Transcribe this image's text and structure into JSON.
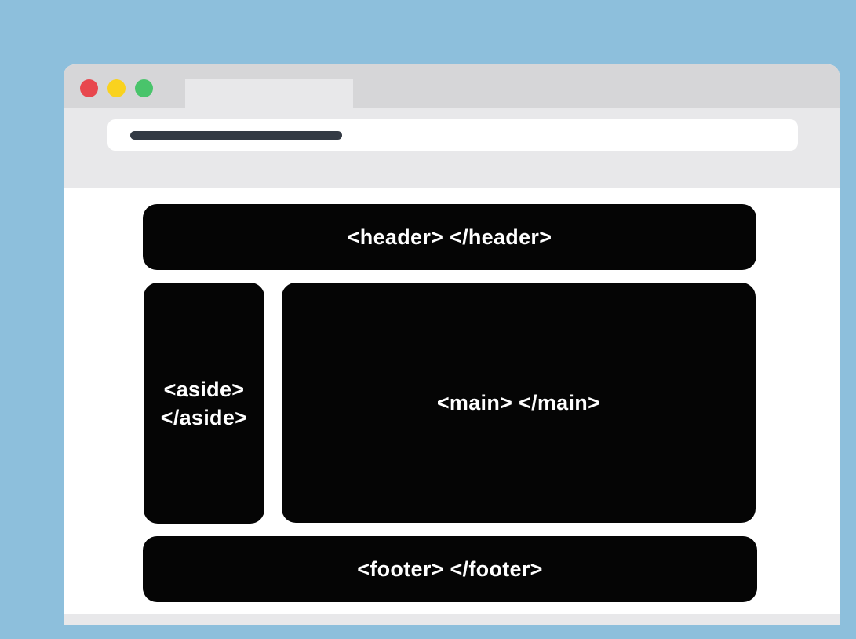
{
  "window": {
    "traffic_lights": {
      "close_color": "#e8474e",
      "minimize_color": "#f9d21e",
      "maximize_color": "#49c46b"
    }
  },
  "colors": {
    "background": "#8dbfdc",
    "block_fill": "#050505",
    "block_text": "#ffffff"
  },
  "layout_blocks": {
    "header": "<header> </header>",
    "aside": [
      "<aside>",
      "</aside>"
    ],
    "main": "<main> </main>",
    "footer": "<footer> </footer>"
  }
}
